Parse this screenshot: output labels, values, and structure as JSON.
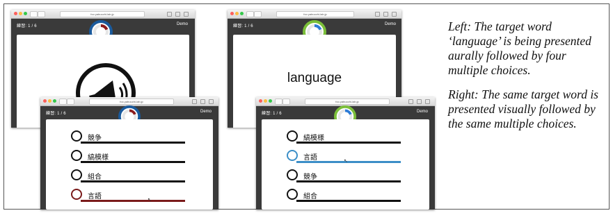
{
  "browser": {
    "url": "foo.yabuuchi-lab.jp"
  },
  "app": {
    "progress_label": "練習: 1 / 6",
    "user_label": "Demo",
    "timer_colors": {
      "aural": "#1a5a9c",
      "visual": "#7bbf3a",
      "remaining_aural": "#8b1c1c",
      "remaining_visual": "#2c7bd6"
    }
  },
  "left_top": {
    "stimulus_icon": "megaphone-speaker-icon"
  },
  "right_top": {
    "target_word": "language"
  },
  "left_bottom": {
    "choices": [
      {
        "text": "競争",
        "state": "normal"
      },
      {
        "text": "縞模様",
        "state": "normal"
      },
      {
        "text": "組合",
        "state": "normal"
      },
      {
        "text": "言語",
        "state": "selected"
      }
    ],
    "selected_color": "#7a1a1a"
  },
  "right_bottom": {
    "choices": [
      {
        "text": "縞模様",
        "state": "normal"
      },
      {
        "text": "言語",
        "state": "selected"
      },
      {
        "text": "競争",
        "state": "normal"
      },
      {
        "text": "組合",
        "state": "normal"
      }
    ],
    "selected_color": "#3b8ec7"
  },
  "caption": {
    "left_text": "Left: The target word ‘language’ is being presented aurally followed by four multiple choices.",
    "right_text": "Right: The same target word is presented visually followed by the same multiple choices."
  }
}
